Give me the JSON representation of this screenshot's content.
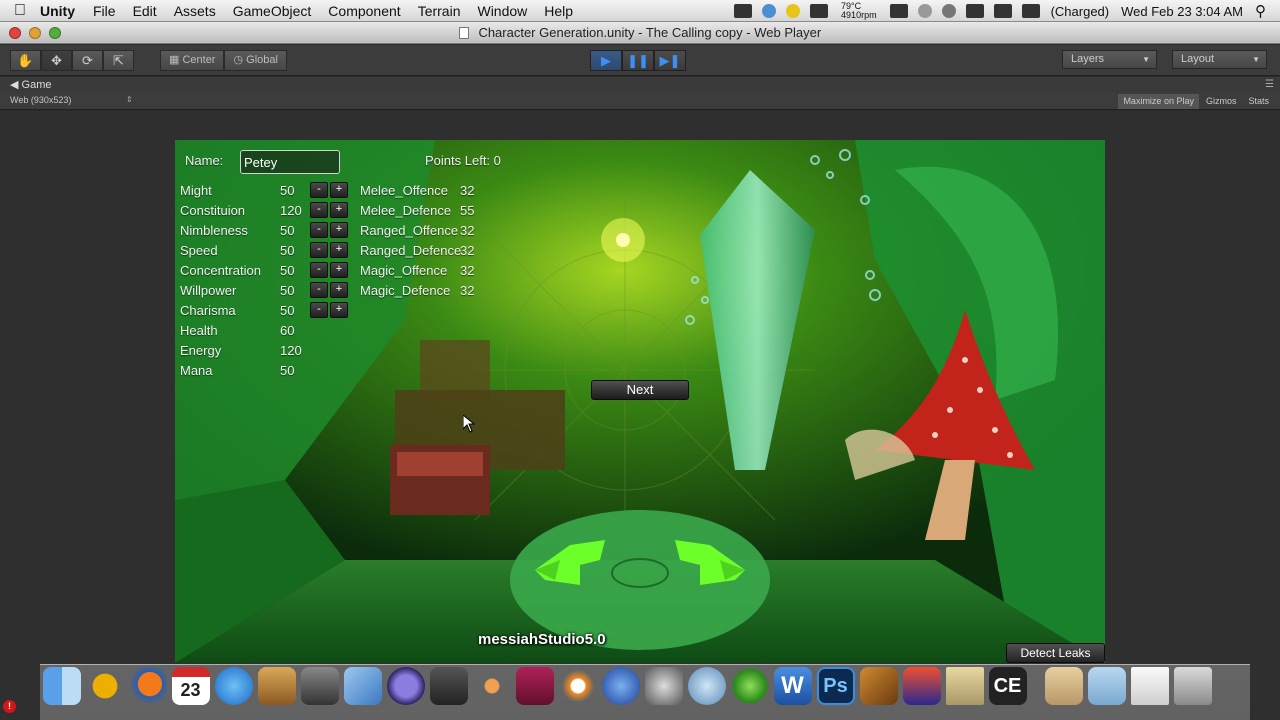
{
  "menubar": {
    "app": "Unity",
    "items": [
      "File",
      "Edit",
      "Assets",
      "GameObject",
      "Component",
      "Terrain",
      "Window",
      "Help"
    ],
    "temp": "79°C",
    "rpm": "4910rpm",
    "battery": "(Charged)",
    "clock": "Wed Feb 23  3:04 AM"
  },
  "window": {
    "title": "Character Generation.unity - The Calling copy - Web Player"
  },
  "toolbar": {
    "pivot_center": "Center",
    "pivot_global": "Global",
    "layers": "Layers",
    "layout": "Layout"
  },
  "game_view": {
    "tab": "Game",
    "aspect": "Web (930x523)",
    "maximize": "Maximize on Play",
    "gizmos": "Gizmos",
    "stats": "Stats"
  },
  "form": {
    "name_label": "Name:",
    "name_value": "Petey",
    "points_left": "Points Left: 0",
    "stats": [
      {
        "name": "Might",
        "value": "50",
        "adjustable": true
      },
      {
        "name": "Constituion",
        "value": "120",
        "adjustable": true
      },
      {
        "name": "Nimbleness",
        "value": "50",
        "adjustable": true
      },
      {
        "name": "Speed",
        "value": "50",
        "adjustable": true
      },
      {
        "name": "Concentration",
        "value": "50",
        "adjustable": true
      },
      {
        "name": "Willpower",
        "value": "50",
        "adjustable": true
      },
      {
        "name": "Charisma",
        "value": "50",
        "adjustable": true
      },
      {
        "name": "Health",
        "value": "60",
        "adjustable": false
      },
      {
        "name": "Energy",
        "value": "120",
        "adjustable": false
      },
      {
        "name": "Mana",
        "value": "50",
        "adjustable": false
      }
    ],
    "secondary": [
      {
        "name": "Melee_Offence",
        "value": "32"
      },
      {
        "name": "Melee_Defence",
        "value": "55"
      },
      {
        "name": "Ranged_Offence",
        "value": "32"
      },
      {
        "name": "Ranged_Defence",
        "value": "32"
      },
      {
        "name": "Magic_Offence",
        "value": "32"
      },
      {
        "name": "Magic_Defence",
        "value": "32"
      }
    ],
    "minus": "-",
    "plus": "+",
    "next": "Next"
  },
  "overlay": {
    "watermark": "messiahStudio5.0",
    "detect_leaks": "Detect Leaks"
  },
  "dock": {
    "calendar_day": "23",
    "ce_label": "CE",
    "ps_label": "Ps",
    "w_label": "W"
  },
  "colors": {
    "accent_play": "#3f8ef2",
    "scene_green": "#1f7a1f"
  }
}
